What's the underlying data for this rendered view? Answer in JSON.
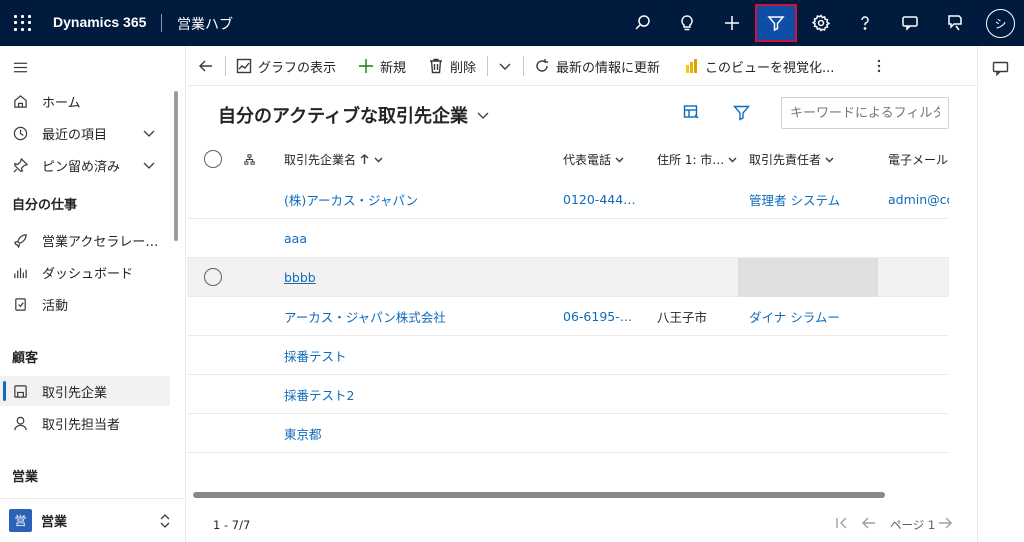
{
  "topbar": {
    "brand": "Dynamics 365",
    "app_name": "営業ハブ",
    "icons": [
      "search-icon",
      "lightbulb-icon",
      "plus-icon",
      "filter-icon",
      "settings-icon",
      "help-icon",
      "feedback-icon",
      "assist-icon"
    ],
    "avatar_initial": "シ"
  },
  "sitemap": {
    "items_top": [
      {
        "label": "ホーム",
        "icon": "home-icon"
      },
      {
        "label": "最近の項目",
        "icon": "clock-icon"
      },
      {
        "label": "ピン留め済み",
        "icon": "pin-icon"
      }
    ],
    "group1": {
      "title": "自分の仕事",
      "items": [
        {
          "label": "営業アクセラレー…",
          "icon": "rocket-icon"
        },
        {
          "label": "ダッシュボード",
          "icon": "dashboard-icon"
        },
        {
          "label": "活動",
          "icon": "activity-icon"
        }
      ]
    },
    "group2": {
      "title": "顧客",
      "items": [
        {
          "label": "取引先企業",
          "icon": "account-icon"
        },
        {
          "label": "取引先担当者",
          "icon": "person-icon"
        }
      ]
    },
    "group3": {
      "title": "営業"
    },
    "area": {
      "badge": "営",
      "label": "営業"
    }
  },
  "commandbar": {
    "show_chart": "グラフの表示",
    "new": "新規",
    "delete": "削除",
    "refresh": "最新の情報に更新",
    "visualize": "このビューを視覚化..."
  },
  "view": {
    "title": "自分のアクティブな取引先企業",
    "search_placeholder": "キーワードによるフィルター"
  },
  "grid": {
    "headers": [
      "取引先企業名",
      "代表電話",
      "住所 1: 市…",
      "取引先責任者",
      "電子メール (既"
    ],
    "rows": [
      {
        "name": "(株)アーカス・ジャパン",
        "phone": "0120-444…",
        "city": "",
        "owner": "管理者 システム",
        "email": "admin@co"
      },
      {
        "name": "aaa",
        "phone": "",
        "city": "",
        "owner": "",
        "email": ""
      },
      {
        "name": "bbbb",
        "phone": "",
        "city": "",
        "owner": "",
        "email": ""
      },
      {
        "name": "アーカス・ジャパン株式会社",
        "phone": "06-6195-…",
        "city": "八王子市",
        "owner": "ダイナ シラムー",
        "email": ""
      },
      {
        "name": "採番テスト",
        "phone": "",
        "city": "",
        "owner": "",
        "email": ""
      },
      {
        "name": "採番テスト2",
        "phone": "",
        "city": "",
        "owner": "",
        "email": ""
      },
      {
        "name": "東京都",
        "phone": "",
        "city": "",
        "owner": "",
        "email": ""
      }
    ]
  },
  "footer": {
    "count": "1 - 7/7",
    "page": "ページ 1"
  }
}
